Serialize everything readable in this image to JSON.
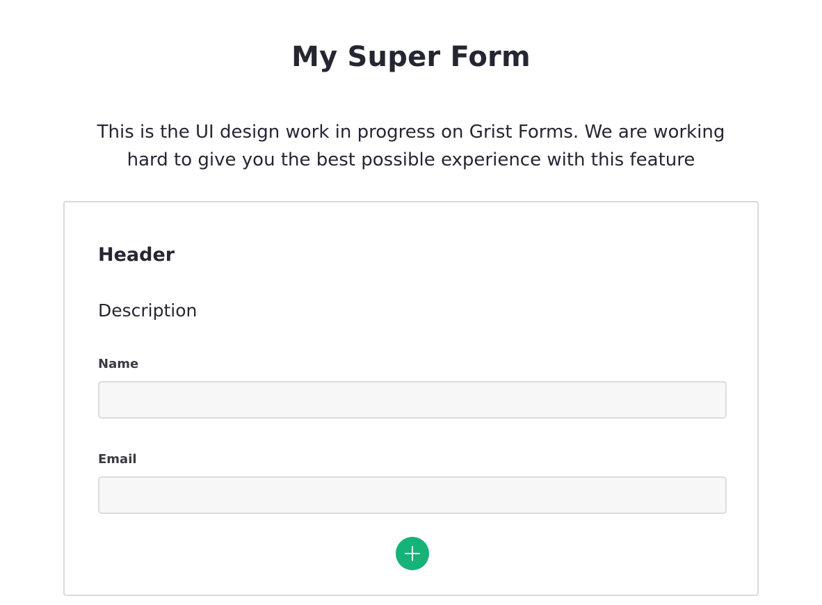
{
  "form": {
    "title": "My Super Form",
    "description": "This is the UI design work in progress on Grist Forms. We are working hard to give you the best possible experience with this feature"
  },
  "section": {
    "header": "Header",
    "description": "Description"
  },
  "fields": [
    {
      "label": "Name",
      "value": "",
      "placeholder": ""
    },
    {
      "label": "Email",
      "value": "",
      "placeholder": ""
    }
  ],
  "add_button": {
    "icon": "plus-icon",
    "color": "#16b378"
  }
}
